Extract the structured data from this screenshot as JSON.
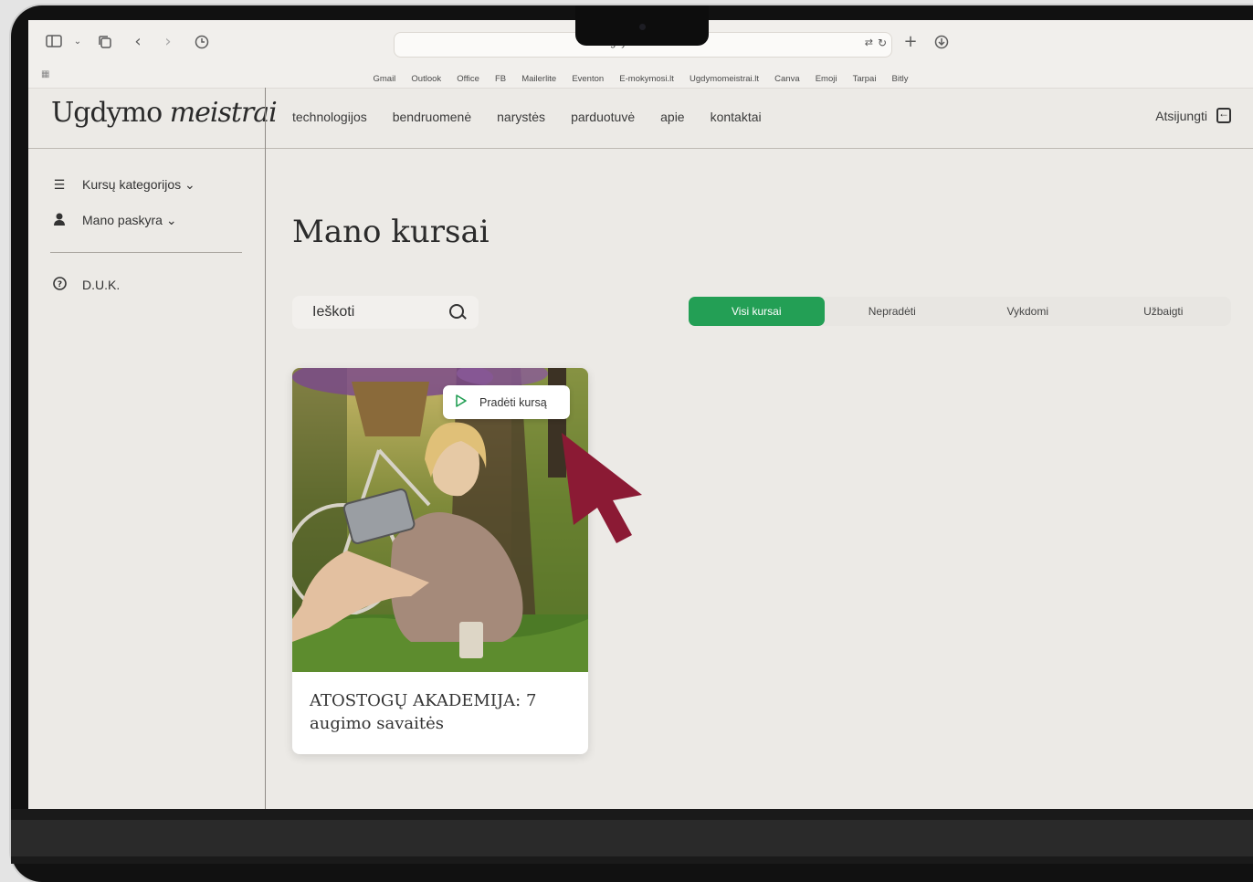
{
  "browser": {
    "url": "ugdymomeistrai.lt",
    "bookmarks": [
      "Gmail",
      "Outlook",
      "Office",
      "FB",
      "Mailerlite",
      "Eventon",
      "E-mokymosi.lt",
      "Ugdymomeistrai.lt",
      "Canva",
      "Emoji",
      "Tarpai",
      "Bitly"
    ]
  },
  "header": {
    "logo_part1": "Ugdymo",
    "logo_part2": "meistrai",
    "nav": [
      "technologijos",
      "bendruomenė",
      "narystės",
      "parduotuvė",
      "apie",
      "kontaktai"
    ],
    "logout_label": "Atsijungti"
  },
  "sidebar": {
    "items": [
      {
        "label": "Kursų kategorijos ⌄",
        "icon": "list-icon"
      },
      {
        "label": "Mano paskyra ⌄",
        "icon": "user-icon"
      },
      {
        "label": "D.U.K.",
        "icon": "question-circle-icon"
      }
    ]
  },
  "main": {
    "title": "Mano kursai",
    "search_placeholder": "Ieškoti",
    "filters": [
      "Visi kursai",
      "Nepradėti",
      "Vykdomi",
      "Užbaigti"
    ],
    "active_filter": "Visi kursai",
    "course": {
      "title": "ATOSTOGŲ AKADEMIJA: 7 augimo savaitės",
      "start_label": "Pradėti kursą"
    }
  },
  "colors": {
    "accent_green": "#239f55",
    "cursor": "#8b1a34",
    "page_bg": "#eceae6"
  }
}
